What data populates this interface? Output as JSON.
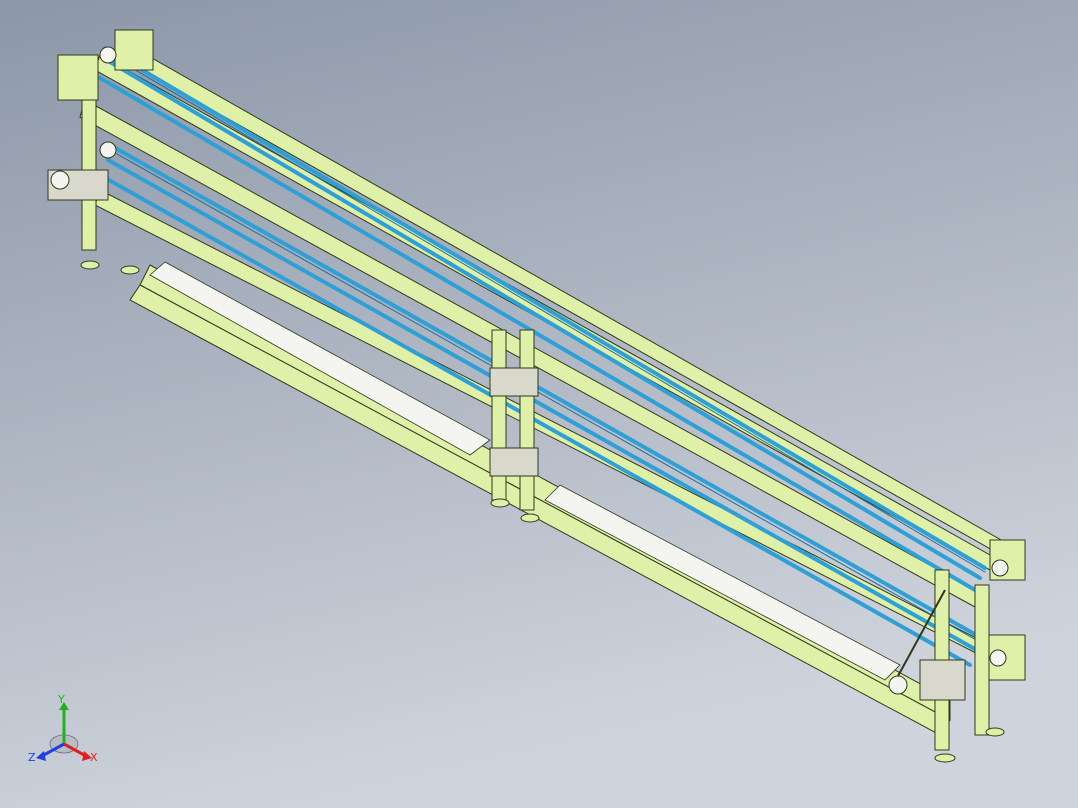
{
  "viewport": {
    "background_top": "#8c97a8",
    "background_bottom": "#cfd4dc"
  },
  "model": {
    "frame_color": "#dff0a8",
    "frame_edge_color": "#2e3a1c",
    "belt_color": "#2f9fd6",
    "belt_dark_color": "#1d6f9c",
    "plate_color": "#f4f4f0",
    "bracket_color": "#d8d8cc"
  },
  "triad": {
    "x_label": "X",
    "y_label": "Y",
    "z_label": "Z",
    "x_color": "#e02020",
    "y_color": "#20b020",
    "z_color": "#2040e0"
  }
}
